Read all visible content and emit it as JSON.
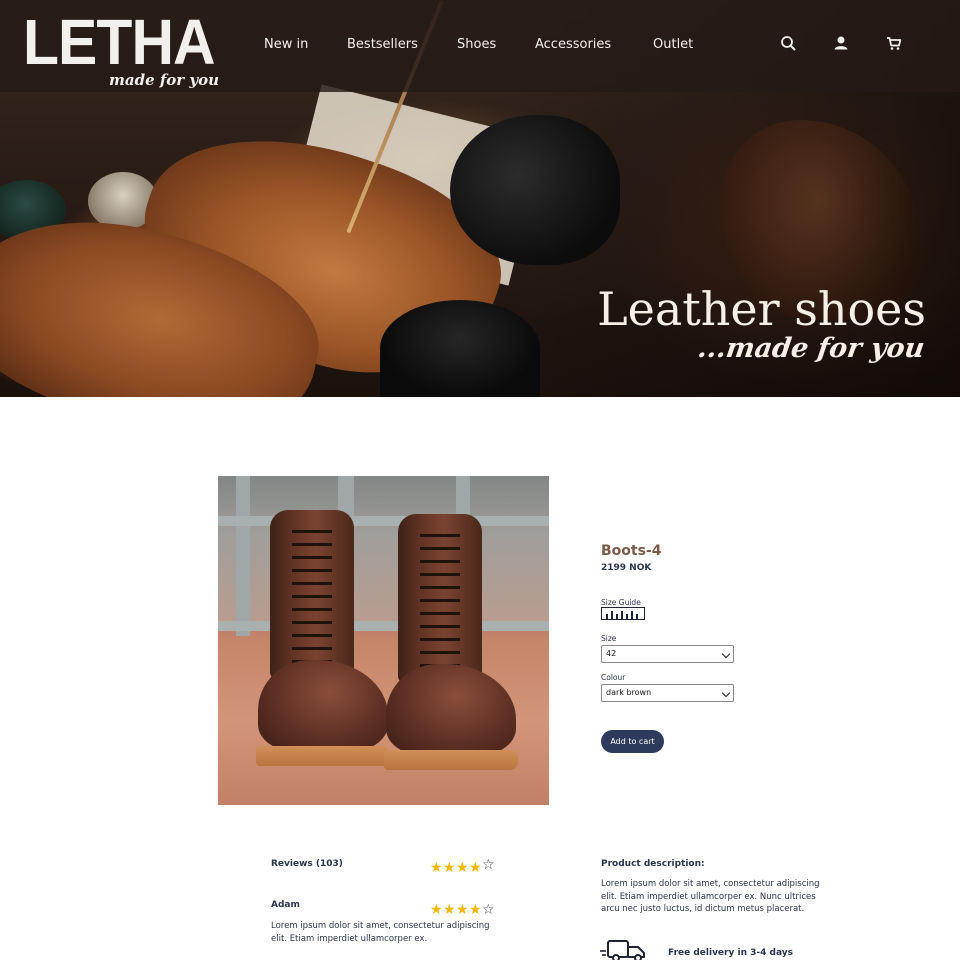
{
  "brand": {
    "logo_text": "LETHA",
    "tagline": "made for you"
  },
  "nav": {
    "items": [
      {
        "label": "New in"
      },
      {
        "label": "Bestsellers"
      },
      {
        "label": "Shoes"
      },
      {
        "label": "Accessories"
      },
      {
        "label": "Outlet"
      }
    ],
    "icons": [
      "search-icon",
      "user-icon",
      "cart-icon"
    ]
  },
  "hero": {
    "title": "Leather shoes",
    "subtitle": "...made for you"
  },
  "product": {
    "name": "Boots-4",
    "price": "2199 NOK",
    "size_guide_label": "Size Guide",
    "size_label": "Size",
    "size_value": "42",
    "colour_label": "Colour",
    "colour_value": "dark brown",
    "add_to_cart": "Add to cart"
  },
  "reviews": {
    "heading": "Reviews (103)",
    "average_rating": 4.5,
    "items": [
      {
        "author": "Adam",
        "rating": 4,
        "text": "Lorem ipsum dolor sit amet, consectetur adipiscing elit. Etiam imperdiet ullamcorper ex."
      }
    ]
  },
  "description": {
    "heading": "Product description:",
    "text": "Lorem ipsum dolor sit amet, consectetur adipiscing elit. Etiam imperdiet ullamcorper ex. Nunc ultrices arcu nec justo luctus, id dictum metus placerat.",
    "delivery": "Free delivery in 3-4 days"
  },
  "colors": {
    "header_bg": "#241a16",
    "title_brown": "#7b5a48",
    "navy": "#2e3a5c",
    "star_gold": "#f0b800"
  }
}
